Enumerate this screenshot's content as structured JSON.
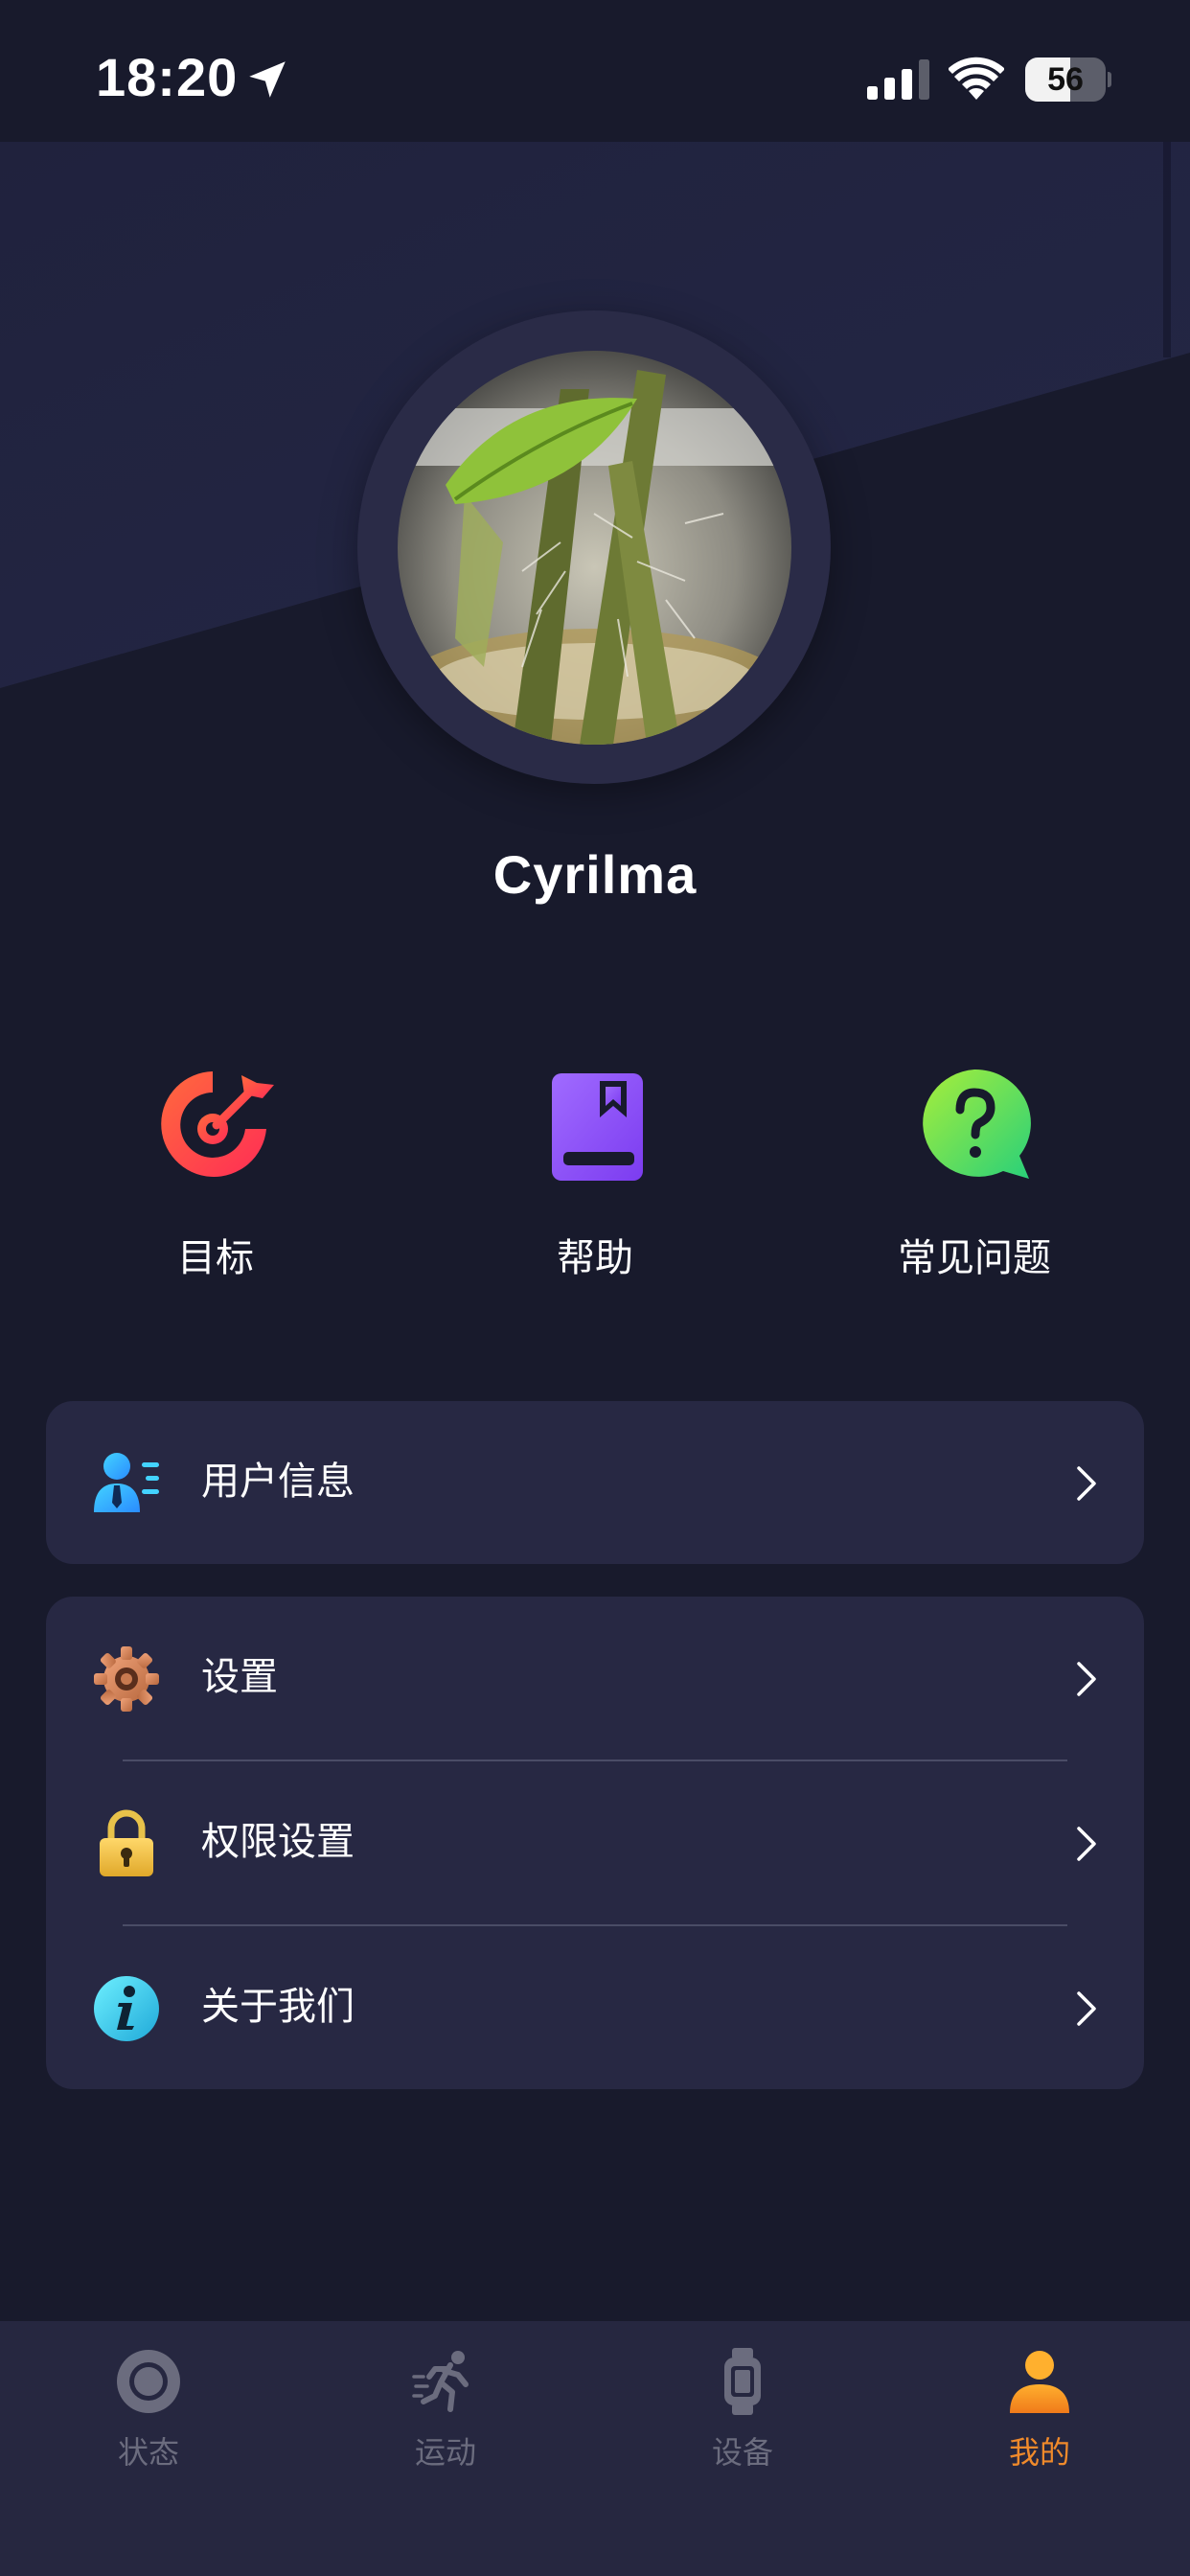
{
  "status_bar": {
    "time": "18:20",
    "battery": "56",
    "battery_level": 0.56
  },
  "profile": {
    "username": "Cyrilma"
  },
  "quick_actions": [
    {
      "label": "目标",
      "icon": "target-icon"
    },
    {
      "label": "帮助",
      "icon": "book-icon"
    },
    {
      "label": "常见问题",
      "icon": "question-bubble-icon"
    }
  ],
  "menu": {
    "group1": [
      {
        "label": "用户信息",
        "icon": "user-info-icon"
      }
    ],
    "group2": [
      {
        "label": "设置",
        "icon": "gear-icon"
      },
      {
        "label": "权限设置",
        "icon": "lock-icon"
      },
      {
        "label": "关于我们",
        "icon": "info-icon"
      }
    ]
  },
  "tabbar": {
    "tabs": [
      {
        "label": "状态",
        "icon": "status-ring-icon",
        "active": false
      },
      {
        "label": "运动",
        "icon": "running-icon",
        "active": false
      },
      {
        "label": "设备",
        "icon": "watch-icon",
        "active": false
      },
      {
        "label": "我的",
        "icon": "person-icon",
        "active": true
      }
    ]
  },
  "colors": {
    "background": "#181a2c",
    "card": "#272843",
    "tab_active": "#f08a2b",
    "tab_inactive": "#6b6c7e"
  }
}
